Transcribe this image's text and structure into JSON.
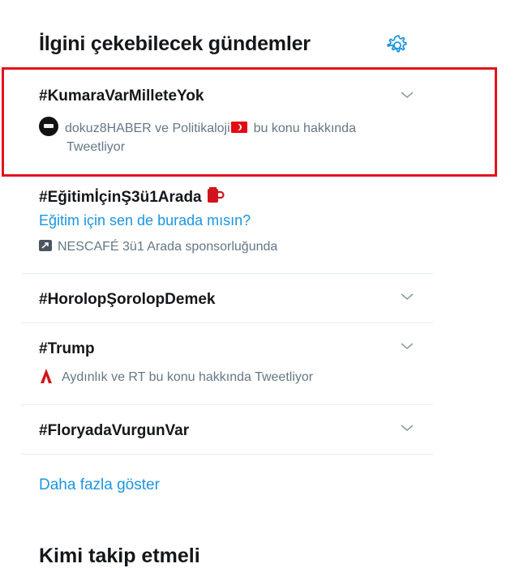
{
  "panel": {
    "title": "İlgini çekebilecek gündemler",
    "show_more": "Daha fazla göster",
    "next_section_title": "Kimi takip etmeli"
  },
  "trends": [
    {
      "tag": "#KumaraVarMilleteYok",
      "context_accounts": "dokuz8HABER ve Politikaloji",
      "context_suffix": "bu konu hakkında",
      "context_line2": "Tweetliyor"
    },
    {
      "tag": "#EğitimİçinŞ3ü1Arada",
      "description": "Eğitim için sen de burada mısın?",
      "promoted_by": "NESCAFÉ 3ü1 Arada sponsorluğunda"
    },
    {
      "tag": "#HorolopŞorolopDemek"
    },
    {
      "tag": "#Trump",
      "context": "Aydınlık ve RT bu konu hakkında Tweetliyor"
    },
    {
      "tag": "#FloryadaVurgunVar"
    }
  ],
  "colors": {
    "accent": "#1b95e0",
    "highlight_border": "#e0141e",
    "secondary_text": "#657786"
  },
  "icons": {
    "settings": "gear-icon",
    "caret": "chevron-down-icon",
    "promoted": "promoted-icon",
    "cup": "coffee-cup-icon",
    "news": "news-logo-icon"
  }
}
